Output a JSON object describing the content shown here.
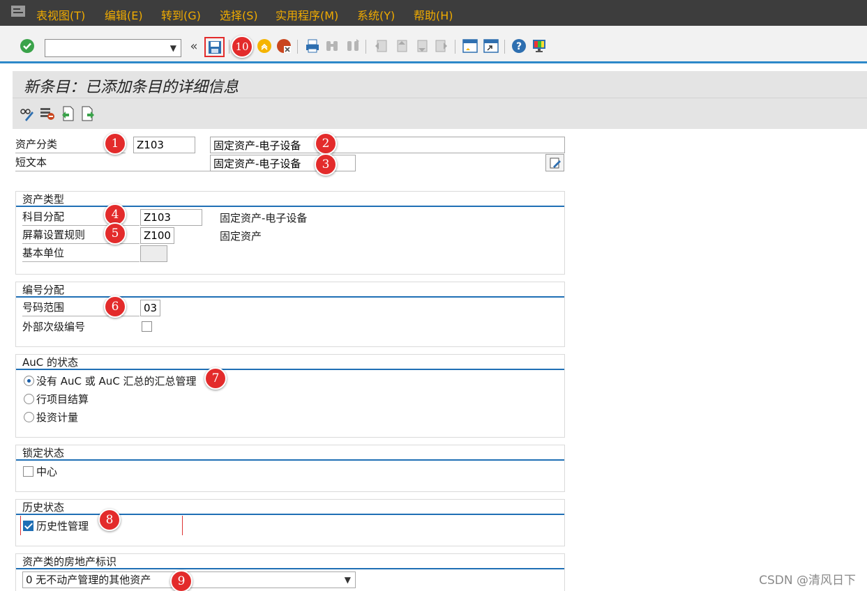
{
  "menu": {
    "items": [
      "表视图(T)",
      "编辑(E)",
      "转到(G)",
      "选择(S)",
      "实用程序(M)",
      "系统(Y)",
      "帮助(H)"
    ]
  },
  "toolbar": {
    "command_value": "",
    "icons": [
      "enter-icon",
      "save-icon",
      "back-icon",
      "cancel-icon",
      "print-icon",
      "find-icon",
      "find-next-icon",
      "first-page-icon",
      "prev-page-icon",
      "next-page-icon",
      "last-page-icon",
      "new-session-icon",
      "shortcut-icon",
      "help-icon",
      "layout-icon"
    ]
  },
  "page": {
    "title": "新条目：已添加条目的详细信息"
  },
  "header_fields": {
    "asset_class_label": "资产分类",
    "asset_class_value": "Z103",
    "asset_class_desc": "固定资产-电子设备",
    "short_text_label": "短文本",
    "short_text_value": "固定资产-电子设备"
  },
  "asset_type": {
    "title": "资产类型",
    "account_assignment_label": "科目分配",
    "account_assignment_value": "Z103",
    "account_assignment_desc": "固定资产-电子设备",
    "screen_layout_label": "屏幕设置规则",
    "screen_layout_value": "Z100",
    "screen_layout_desc": "固定资产",
    "base_unit_label": "基本单位",
    "base_unit_value": ""
  },
  "number_assignment": {
    "title": "编号分配",
    "number_range_label": "号码范围",
    "number_range_value": "03",
    "external_sub_label": "外部次级编号",
    "external_sub_checked": false
  },
  "auc_status": {
    "title": "AuC 的状态",
    "options": [
      "没有 AuC 或 AuC 汇总的汇总管理",
      "行项目结算",
      "投资计量"
    ],
    "selected_index": 0
  },
  "lock_status": {
    "title": "锁定状态",
    "central_label": "中心",
    "central_checked": false
  },
  "history_status": {
    "title": "历史状态",
    "history_label": "历史性管理",
    "history_checked": true
  },
  "real_estate": {
    "title": "资产类的房地产标识",
    "selected": "0 无不动产管理的其他资产"
  },
  "annotations": [
    "1",
    "2",
    "3",
    "4",
    "5",
    "6",
    "7",
    "8",
    "9",
    "10"
  ],
  "watermark": "CSDN @清风日下",
  "colors": {
    "menu_bg": "#3d3d3d",
    "menu_text": "#f0ab00",
    "accent_blue": "#1f6fb5",
    "badge_red": "#e32b2b"
  }
}
